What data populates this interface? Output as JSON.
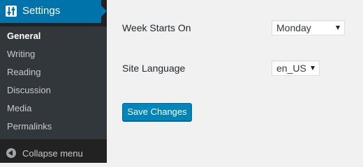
{
  "sidebar": {
    "header": {
      "label": "Settings",
      "icon": "settings-sliders-icon"
    },
    "items": [
      {
        "label": "General",
        "current": true
      },
      {
        "label": "Writing",
        "current": false
      },
      {
        "label": "Reading",
        "current": false
      },
      {
        "label": "Discussion",
        "current": false
      },
      {
        "label": "Media",
        "current": false
      },
      {
        "label": "Permalinks",
        "current": false
      }
    ],
    "collapse": {
      "label": "Collapse menu",
      "icon": "collapse-arrow-icon"
    }
  },
  "form": {
    "week_starts_on": {
      "label": "Week Starts On",
      "value": "Monday"
    },
    "site_language": {
      "label": "Site Language",
      "value": "en_US"
    },
    "save_label": "Save Changes"
  },
  "colors": {
    "sidebar_bg": "#222222",
    "submenu_bg": "#32373c",
    "accent": "#0073aa",
    "button": "#0085ba",
    "page_bg": "#f1f1f1"
  }
}
